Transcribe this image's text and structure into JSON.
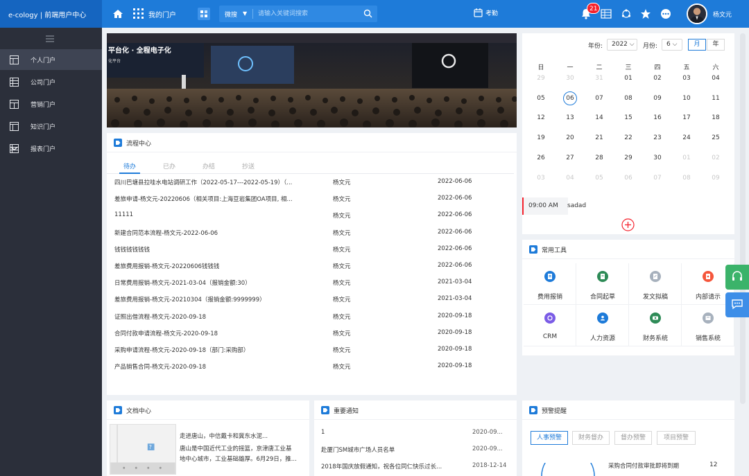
{
  "header": {
    "brand": "e-cology | 前端用户中心",
    "my_portal": "我的门户",
    "search": {
      "type": "微搜",
      "placeholder": "请输入关键词搜索"
    },
    "attendance": "考勤",
    "notification_count": "21",
    "user_name": "杨文元"
  },
  "sidebar": {
    "items": [
      {
        "label": "个人门户",
        "icon": "portal-icon",
        "active": true
      },
      {
        "label": "公司门户",
        "icon": "table-icon"
      },
      {
        "label": "营销门户",
        "icon": "calendar-grid-icon"
      },
      {
        "label": "知识门户",
        "icon": "window-icon"
      },
      {
        "label": "报表门户",
        "icon": "report-icon",
        "has_submenu": true
      }
    ]
  },
  "banner": {
    "text1": "平台化 · 全程电子化",
    "text2": "化平台"
  },
  "process": {
    "title": "流程中心",
    "tabs": [
      "待办",
      "已办",
      "办结",
      "抄送"
    ],
    "rows": [
      {
        "title": "四川巴塘县拉哇水电站调研工作（2022-05-17---2022-05-19）（...",
        "creator": "杨文元",
        "date": "2022-06-06"
      },
      {
        "title": "差旅申请-杨文元-20220606（相关项目:上海豆岩集团OA项目, 相...",
        "creator": "杨文元",
        "date": "2022-06-06"
      },
      {
        "title": "11111",
        "creator": "杨文元",
        "date": "2022-06-06"
      },
      {
        "title": "新建合同范本流程-杨文元-2022-06-06",
        "creator": "杨文元",
        "date": "2022-06-06"
      },
      {
        "title": "钱钱钱钱钱钱",
        "creator": "杨文元",
        "date": "2022-06-06"
      },
      {
        "title": "差旅费用报销-杨文元-20220606钱钱钱",
        "creator": "杨文元",
        "date": "2022-06-06"
      },
      {
        "title": "日常费用报销-杨文元-2021-03-04（报销金额:30）",
        "creator": "杨文元",
        "date": "2021-03-04"
      },
      {
        "title": "差旅费用报销-杨文元-20210304（报销金额:9999999）",
        "creator": "杨文元",
        "date": "2021-03-04"
      },
      {
        "title": "证照出借流程-杨文元-2020-09-18",
        "creator": "杨文元",
        "date": "2020-09-18"
      },
      {
        "title": "合同付款申请流程-杨文元-2020-09-18",
        "creator": "杨文元",
        "date": "2020-09-18"
      },
      {
        "title": "采购申请流程-杨文元-2020-09-18（部门:采购部）",
        "creator": "杨文元",
        "date": "2020-09-18"
      },
      {
        "title": "产品销售合同-杨文元-2020-09-18",
        "creator": "杨文元",
        "date": "2020-09-18"
      }
    ]
  },
  "calendar": {
    "year_label": "年份:",
    "year": "2022",
    "month_label": "月份:",
    "month": "6",
    "view_month": "月",
    "view_year": "年",
    "weekdays": [
      "日",
      "一",
      "二",
      "三",
      "四",
      "五",
      "六"
    ],
    "weeks": [
      [
        {
          "d": "29",
          "m": true
        },
        {
          "d": "30",
          "m": true
        },
        {
          "d": "31",
          "m": true
        },
        {
          "d": "01"
        },
        {
          "d": "02"
        },
        {
          "d": "03"
        },
        {
          "d": "04"
        }
      ],
      [
        {
          "d": "05"
        },
        {
          "d": "06",
          "today": true
        },
        {
          "d": "07"
        },
        {
          "d": "08"
        },
        {
          "d": "09"
        },
        {
          "d": "10"
        },
        {
          "d": "11"
        }
      ],
      [
        {
          "d": "12"
        },
        {
          "d": "13"
        },
        {
          "d": "14"
        },
        {
          "d": "15"
        },
        {
          "d": "16"
        },
        {
          "d": "17"
        },
        {
          "d": "18"
        }
      ],
      [
        {
          "d": "19"
        },
        {
          "d": "20"
        },
        {
          "d": "21"
        },
        {
          "d": "22"
        },
        {
          "d": "23"
        },
        {
          "d": "24"
        },
        {
          "d": "25"
        }
      ],
      [
        {
          "d": "26"
        },
        {
          "d": "27"
        },
        {
          "d": "28"
        },
        {
          "d": "29"
        },
        {
          "d": "30"
        },
        {
          "d": "01",
          "m": true
        },
        {
          "d": "02",
          "m": true
        }
      ],
      [
        {
          "d": "03",
          "m": true
        },
        {
          "d": "04",
          "m": true
        },
        {
          "d": "05",
          "m": true
        },
        {
          "d": "06",
          "m": true
        },
        {
          "d": "07",
          "m": true
        },
        {
          "d": "08",
          "m": true
        },
        {
          "d": "09",
          "m": true
        }
      ]
    ],
    "event": {
      "time": "09:00 AM",
      "text": "sadad"
    }
  },
  "tools": {
    "title": "常用工具",
    "items": [
      {
        "label": "费用报销",
        "color": "#1e7bd9",
        "icon": "receipt-icon"
      },
      {
        "label": "合同起草",
        "color": "#2e8b57",
        "icon": "contract-icon"
      },
      {
        "label": "发文拟稿",
        "color": "#a7b1bd",
        "icon": "draft-icon"
      },
      {
        "label": "内部请示",
        "color": "#f5563b",
        "icon": "request-icon"
      },
      {
        "label": "CRM",
        "color": "#7b5ce6",
        "icon": "crm-icon"
      },
      {
        "label": "人力资源",
        "color": "#1e7bd9",
        "icon": "hr-icon"
      },
      {
        "label": "财务系统",
        "color": "#2e8b57",
        "icon": "finance-icon"
      },
      {
        "label": "销售系统",
        "color": "#a7b1bd",
        "icon": "sales-icon"
      }
    ]
  },
  "docs": {
    "title": "文档中心",
    "headline": "走进唐山，中信戴卡和冀东水泥...",
    "summary1": "唐山是中国近代工业的摇篮，京津唐工业基",
    "summary2": "地中心城市，工业基础雄厚。6月29日，推..."
  },
  "notices": {
    "title": "重要通知",
    "rows": [
      {
        "title": "1",
        "date": "2020-09..."
      },
      {
        "title": "赴厦门SM城市广场人员名单",
        "date": "2020-09..."
      },
      {
        "title": "2018年国庆放假通知，祝各位同仁快乐过长...",
        "date": "2018-12-14"
      }
    ]
  },
  "alerts": {
    "title": "预警提醒",
    "tabs": [
      "人事预警",
      "财务督办",
      "督办预警",
      "项目预警"
    ],
    "item": "采购合同付款审批即将到期",
    "count": "12"
  },
  "colors": {
    "primary": "#1e7bd9",
    "sidebar": "#2b2f3a",
    "alert": "#f5222d",
    "float_green": "#3bb36a",
    "float_blue": "#3d8ee8"
  }
}
